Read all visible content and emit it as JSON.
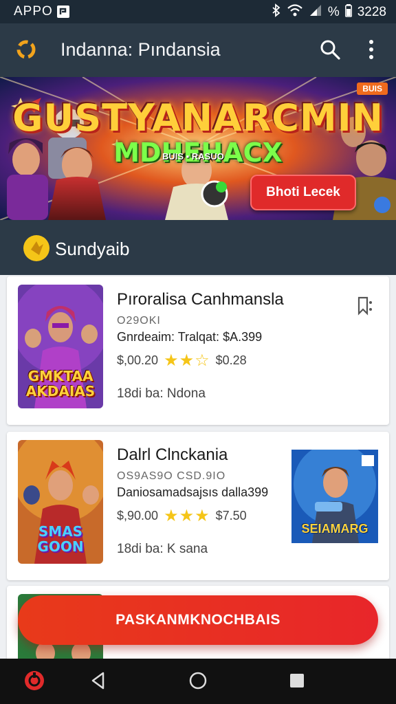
{
  "status_bar": {
    "left_text": "APPO",
    "time": "3228",
    "battery": "%"
  },
  "app_bar": {
    "title": "Indanna: Pındansia"
  },
  "banner": {
    "headline": "GUSTYANARCMIN",
    "sub_headline": "MDHEHACX",
    "tagline": "BUIS ▪ RASUO",
    "cta_label": "Bhoti Lecek",
    "badge": "BUIS"
  },
  "section": {
    "title": "Sundyaib"
  },
  "cards": [
    {
      "name": "Pıroralisa Canhmansla",
      "code": "O29OKI",
      "detail": "Gnrdeaim: Tralqat: $A.399",
      "price": "$,00.20",
      "stars": "★★☆",
      "rating_price": "$0.28",
      "meta": "18di ba: Ndona",
      "thumb_text": "GMKTAA\nAKDAIAS",
      "has_bookmark": true
    },
    {
      "name": "Dalrl Clnckania",
      "code": "OS9AS9O  CSD.9IO",
      "detail": "Daniosamadsajsıs dalla399",
      "price": "$,90.00",
      "stars": "★★★",
      "rating_price": "$7.50",
      "meta": "18di ba: K sana",
      "thumb_text": "SMAS\nGOON",
      "side_text": "SEIAMARG"
    }
  ],
  "fab": {
    "label": "PASKANMKNOCHBAIS"
  },
  "colors": {
    "app_bar": "#2c3a47",
    "status_bar": "#1d2a36",
    "accent": "#e8262a",
    "star": "#f5c518"
  }
}
